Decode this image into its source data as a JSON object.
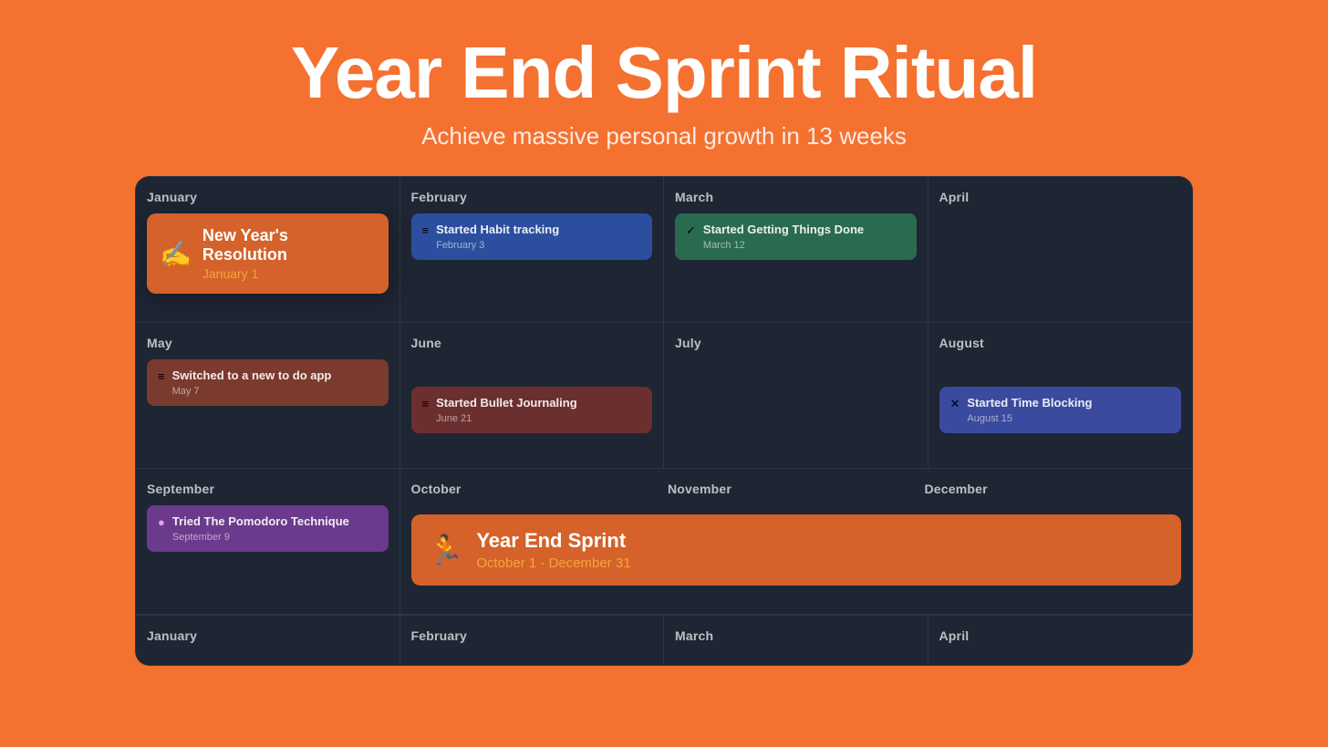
{
  "header": {
    "title": "Year End Sprint Ritual",
    "subtitle": "Achieve massive personal growth in 13 weeks"
  },
  "calendar": {
    "rows": [
      {
        "months": [
          {
            "name": "January",
            "events": [
              {
                "type": "highlighted",
                "emoji": "✍️",
                "title": "New Year's Resolution",
                "date": "January 1",
                "color": "orange"
              }
            ]
          },
          {
            "name": "February",
            "events": [
              {
                "icon": "☰",
                "title": "Started Habit tracking",
                "date": "February 3",
                "color": "blue"
              }
            ]
          },
          {
            "name": "March",
            "events": [
              {
                "icon": "✓",
                "title": "Started Getting Things Done",
                "date": "March 12",
                "color": "green"
              }
            ]
          },
          {
            "name": "April",
            "events": []
          }
        ]
      },
      {
        "months": [
          {
            "name": "May",
            "events": [
              {
                "icon": "☰",
                "title": "Switched to a new to do app",
                "date": "May 7",
                "color": "brown"
              }
            ]
          },
          {
            "name": "June",
            "events": [
              {
                "icon": "☰",
                "title": "Started Bullet Journaling",
                "date": "June 21",
                "color": "red-brown"
              }
            ]
          },
          {
            "name": "July",
            "events": []
          },
          {
            "name": "August",
            "events": [
              {
                "icon": "✕",
                "title": "Started Time Blocking",
                "date": "August 15",
                "color": "indigo"
              }
            ]
          }
        ]
      },
      {
        "months": [
          {
            "name": "September",
            "events": [
              {
                "icon": "●",
                "title": "Tried The Pomodoro Technique",
                "date": "September 9",
                "color": "purple"
              }
            ]
          },
          {
            "name": "October-December",
            "span": 3,
            "special": {
              "emoji": "🏃",
              "title": "Year End Sprint",
              "dateRange": "October 1 - December 31"
            }
          }
        ]
      }
    ],
    "bottomRow": [
      "January",
      "February",
      "March",
      "April"
    ]
  }
}
